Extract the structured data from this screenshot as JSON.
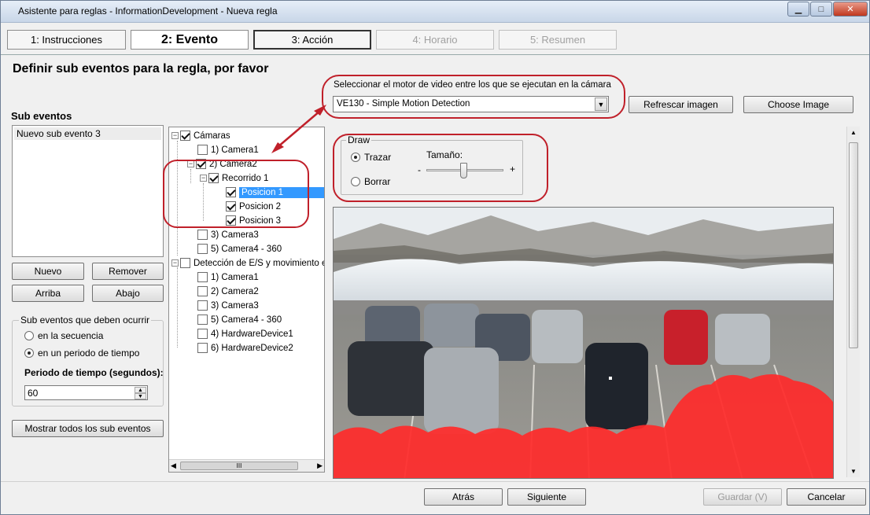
{
  "window": {
    "title": "Asistente para reglas - InformationDevelopment - Nueva regla"
  },
  "window_controls": {
    "minimize": "▁",
    "maximize": "□",
    "close": "✕"
  },
  "steps": [
    {
      "label": "1: Instrucciones"
    },
    {
      "label": "2: Evento"
    },
    {
      "label": "3: Acción"
    },
    {
      "label": "4: Horario"
    },
    {
      "label": "5: Resumen"
    }
  ],
  "page_heading": "Definir sub eventos para la regla, por favor",
  "sub_events": {
    "title": "Sub eventos",
    "items": [
      "Nuevo sub evento 3"
    ],
    "buttons": {
      "new": "Nuevo",
      "remove": "Remover",
      "up": "Arriba",
      "down": "Abajo"
    },
    "group_title": "Sub eventos que deben ocurrir",
    "option_sequence": "en la secuencia",
    "option_period": "en un periodo de tiempo",
    "period_label": "Periodo de tiempo (segundos):",
    "period_value": "60",
    "show_all": "Mostrar todos los sub eventos"
  },
  "tree": {
    "cameras": "Cámaras",
    "camera1": "1) Camera1",
    "camera2": "2) Camera2",
    "route": "Recorrido 1",
    "pos1": "Posicion 1",
    "pos2": "Posicion 2",
    "pos3": "Posicion 3",
    "camera3": "3) Camera3",
    "camera4": "5) Camera4 - 360",
    "io_group": "Detección de E/S y movimiento e",
    "io_camera1": "1) Camera1",
    "io_camera2": "2) Camera2",
    "io_camera3": "3) Camera3",
    "io_camera4": "5) Camera4 - 360",
    "hw1": "4) HardwareDevice1",
    "hw2": "6) HardwareDevice2",
    "scroll_grip": "III"
  },
  "engine": {
    "label": "Seleccionar el motor de video entre los que se ejecutan en la cámara",
    "value": "VE130 - Simple Motion Detection",
    "refresh": "Refrescar imagen",
    "choose": "Choose Image"
  },
  "draw": {
    "title": "Draw",
    "trace": "Trazar",
    "erase": "Borrar",
    "size_label": "Tamaño:",
    "minus": "-",
    "plus": "+"
  },
  "footer": {
    "back": "Atrás",
    "next": "Siguiente",
    "save": "Guardar (V)",
    "cancel": "Cancelar"
  },
  "colors": {
    "annotation": "#c0202a",
    "selection": "#3399ff",
    "mask": "#ff2a2a"
  }
}
